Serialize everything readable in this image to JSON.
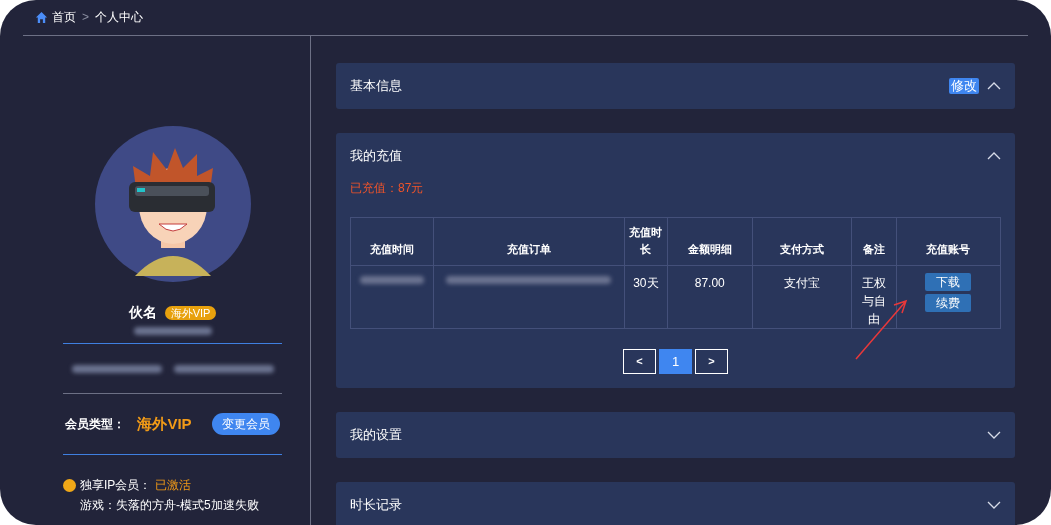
{
  "breadcrumb": {
    "items": [
      {
        "label": "首页",
        "kind": "home"
      },
      {
        "label": "个人中心",
        "kind": "page"
      }
    ],
    "separator": ">"
  },
  "profile": {
    "name": "伙名",
    "badge": "海外VIP",
    "member_type_label": "会员类型：",
    "member_type": "海外VIP",
    "change_button": "变更会员",
    "exclusive_label": "独享IP会员：",
    "exclusive_status": "已激活",
    "game": "游戏：失落的方舟-模式5加速失败"
  },
  "panels": [
    {
      "title": "基本信息",
      "expanded": true,
      "action": "修改",
      "kind": "basic"
    },
    {
      "title": "我的充值",
      "expanded": true,
      "kind": "recharge"
    },
    {
      "title": "我的设置",
      "expanded": false,
      "kind": "plain"
    },
    {
      "title": "时长记录",
      "expanded": false,
      "kind": "plain"
    }
  ],
  "recharge": {
    "total": "已充值：87元",
    "columns": [
      "充值时间",
      "充值订单",
      "充值时长",
      "金额明细",
      "支付方式",
      "备注",
      "充值账号"
    ],
    "rows": [
      {
        "duration": "30天",
        "amount": "87.00",
        "method": "支付宝",
        "note": "王权与自由",
        "buttons": [
          "下载",
          "续费"
        ]
      }
    ],
    "pagination": {
      "prev": "<",
      "pages": [
        {
          "label": "1",
          "selected": true
        }
      ],
      "next": ">"
    }
  }
}
